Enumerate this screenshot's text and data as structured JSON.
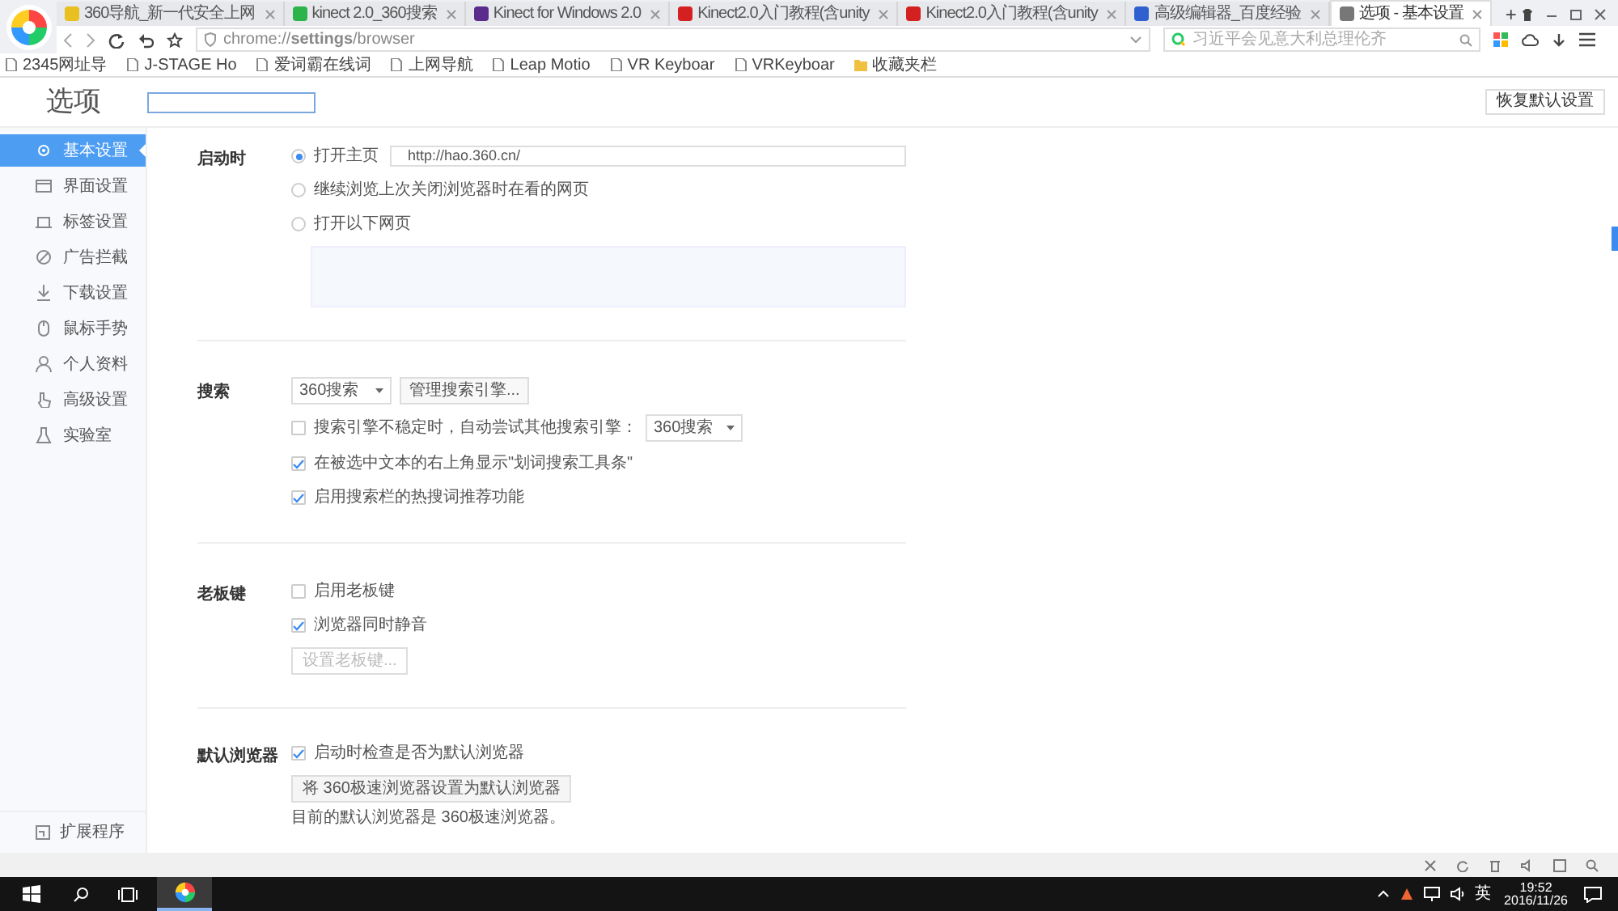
{
  "browser": {
    "tabs": [
      {
        "title": "360导航_新一代安全上网",
        "selected": false
      },
      {
        "title": "kinect 2.0_360搜索",
        "selected": false
      },
      {
        "title": "Kinect for Windows 2.0",
        "selected": false
      },
      {
        "title": "Kinect2.0入门教程(含unity",
        "selected": false
      },
      {
        "title": "Kinect2.0入门教程(含unity",
        "selected": false
      },
      {
        "title": "高级编辑器_百度经验",
        "selected": false
      },
      {
        "title": "选项 - 基本设置",
        "selected": true
      }
    ],
    "new_tab": "+",
    "address": "chrome://**settings**/browser",
    "search_placeholder": "习近平会见意大利总理伦齐",
    "bookmarks": [
      "2345网址导",
      "J-STAGE Ho",
      "爱词霸在线词",
      "上网导航",
      "Leap Motio",
      "VR Keyboar",
      "VRKeyboar",
      "收藏夹栏"
    ]
  },
  "page": {
    "title": "选项",
    "reset_button": "恢复默认设置",
    "sidebar": {
      "items": [
        {
          "label": "基本设置",
          "selected": true
        },
        {
          "label": "界面设置",
          "selected": false
        },
        {
          "label": "标签设置",
          "selected": false
        },
        {
          "label": "广告拦截",
          "selected": false
        },
        {
          "label": "下载设置",
          "selected": false
        },
        {
          "label": "鼠标手势",
          "selected": false
        },
        {
          "label": "个人资料",
          "selected": false
        },
        {
          "label": "高级设置",
          "selected": false
        },
        {
          "label": "实验室",
          "selected": false
        }
      ],
      "footer": "扩展程序"
    },
    "sections": [
      {
        "label": "启动时",
        "rows": [
          {
            "kind": "radio",
            "label": "打开主页",
            "selected": true,
            "value": "http://hao.360.cn/"
          },
          {
            "kind": "radio",
            "label": "继续浏览上次关闭浏览器时在看的网页",
            "selected": false
          },
          {
            "kind": "radio",
            "label": "打开以下网页",
            "selected": false
          },
          {
            "kind": "textarea"
          }
        ]
      },
      {
        "label": "搜索",
        "rows": [
          {
            "kind": "select",
            "select": "360搜索",
            "button": "管理搜索引擎..."
          },
          {
            "kind": "checkbox",
            "label": "搜索引擎不稳定时，自动尝试其他搜索引擎：",
            "checked": false,
            "select": "360搜索"
          },
          {
            "kind": "checkbox",
            "label": "在被选中文本的右上角显示\"划词搜索工具条\"",
            "checked": true
          },
          {
            "kind": "checkbox",
            "label": "启用搜索栏的热搜词推荐功能",
            "checked": true
          }
        ]
      },
      {
        "label": "老板键",
        "rows": [
          {
            "kind": "checkbox",
            "label": "启用老板键",
            "checked": false
          },
          {
            "kind": "checkbox",
            "label": "浏览器同时静音",
            "checked": true
          },
          {
            "kind": "button",
            "label": "设置老板键...",
            "disabled": true
          }
        ]
      },
      {
        "label": "默认浏览器",
        "rows": [
          {
            "kind": "checkbox",
            "label": "启动时检查是否为默认浏览器",
            "checked": true
          },
          {
            "kind": "button",
            "label": "将 360极速浏览器设置为默认浏览器",
            "disabled": false
          },
          {
            "kind": "text",
            "label": "目前的默认浏览器是 360极速浏览器。"
          }
        ]
      }
    ]
  },
  "taskbar": {
    "ime": "英",
    "time": "19:52",
    "date": "2016/11/26"
  }
}
